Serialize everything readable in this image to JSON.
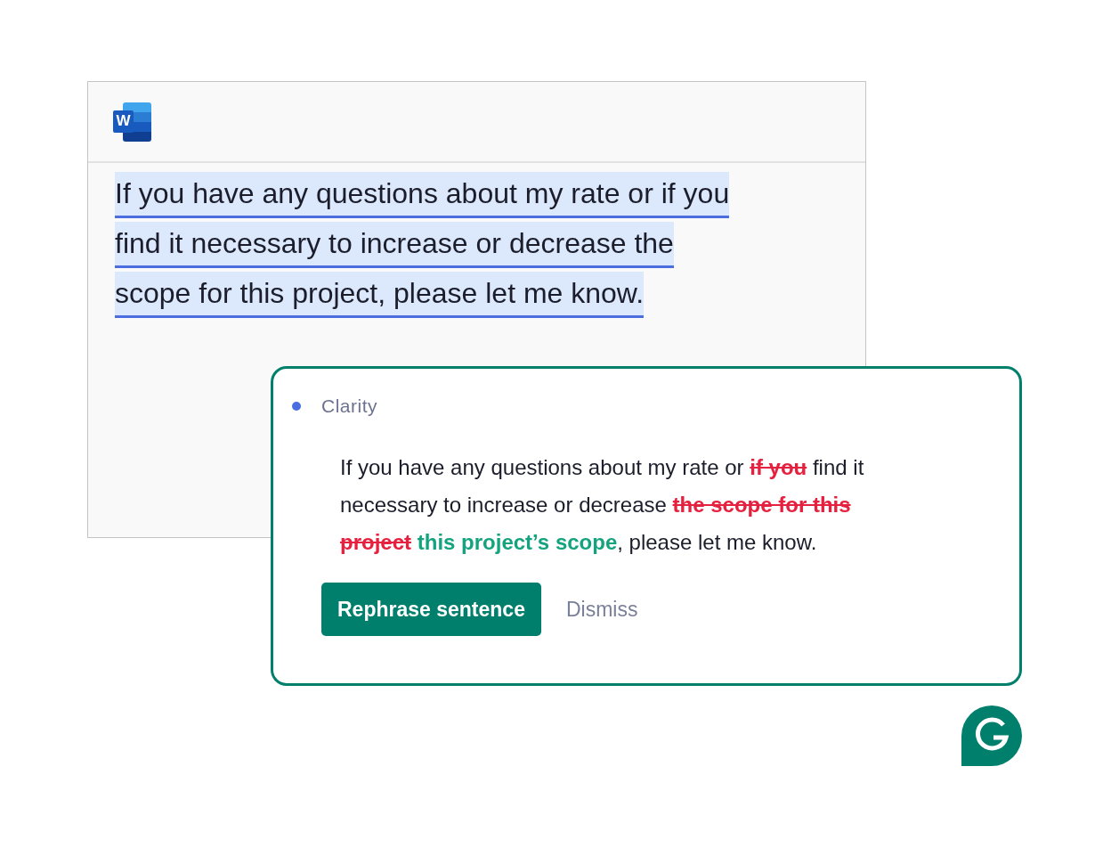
{
  "document": {
    "app_logo_letter": "W",
    "paragraph": "If you have any questions about my rate or if you find it necessary to increase or decrease the scope for this project, please let me know.",
    "highlighted": true
  },
  "suggestion_card": {
    "category": "Clarity",
    "segments": [
      {
        "kind": "plain",
        "text": "If you have any questions about my rate or "
      },
      {
        "kind": "deleted",
        "text": "if you"
      },
      {
        "kind": "plain",
        "text": " find it necessary to increase or decrease "
      },
      {
        "kind": "deleted",
        "text": "the scope for this project"
      },
      {
        "kind": "inserted",
        "text": "this project’s scope"
      },
      {
        "kind": "plain",
        "text": ", please let me know."
      }
    ],
    "buttons": [
      {
        "kind": "primary",
        "label": "Rephrase sentence"
      },
      {
        "kind": "link",
        "label": "Dismiss"
      }
    ]
  }
}
